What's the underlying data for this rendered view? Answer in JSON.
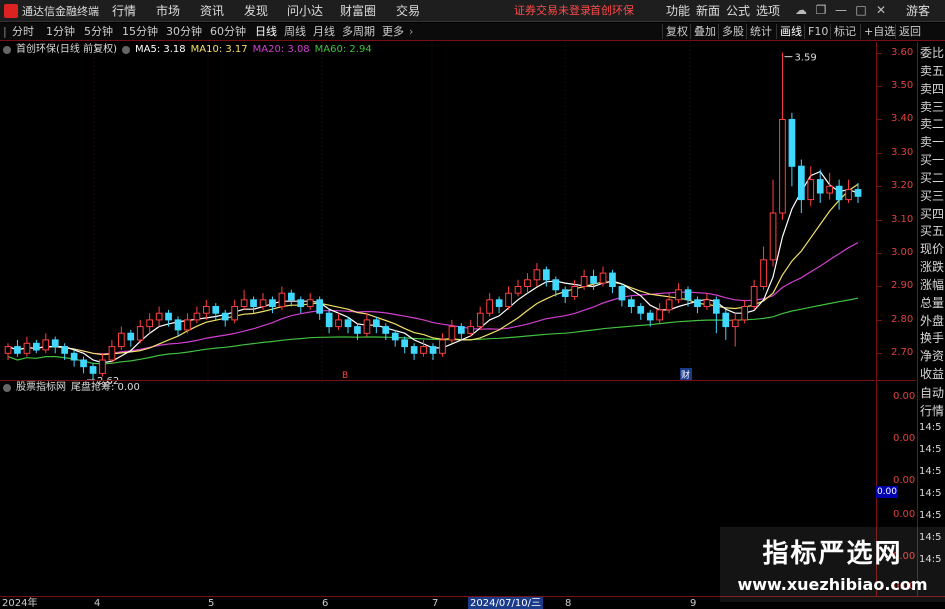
{
  "app": {
    "title": "通达信金融终端",
    "menus": [
      "行情",
      "市场",
      "资讯",
      "发现",
      "问小达",
      "财富圈",
      "交易"
    ],
    "notice": "证券交易未登录",
    "stock_short": "首创环保",
    "right_menus": [
      "功能",
      "新面",
      "公式",
      "选项"
    ],
    "guest": "游客"
  },
  "toolbar": {
    "periods": [
      "分时",
      "1分钟",
      "5分钟",
      "15分钟",
      "30分钟",
      "60分钟",
      "日线",
      "周线",
      "月线",
      "多周期",
      "更多"
    ],
    "active_period": "日线",
    "right_buttons": [
      "复权",
      "叠加",
      "多股",
      "统计",
      "画线",
      "F10",
      "标记",
      "+自选",
      "返回"
    ]
  },
  "main_chart": {
    "stock_label": "首创环保(日线 前复权)",
    "ma5_label": "MA5: 3.18",
    "ma10_label": "MA10: 3.17",
    "ma20_label": "MA20: 3.08",
    "ma60_label": "MA60: 2.94",
    "colors": {
      "ma5": "#ffffff",
      "ma10": "#f2e06a",
      "ma20": "#d040d0",
      "ma60": "#40c040",
      "up": "#ff4040",
      "down": "#40d8ff"
    },
    "high_label": "3.59",
    "low_label": "2.62",
    "marker_1": "B",
    "marker_2": "财"
  },
  "price_axis": [
    "3.60",
    "3.50",
    "3.40",
    "3.30",
    "3.20",
    "3.10",
    "3.00",
    "2.90",
    "2.80",
    "2.70"
  ],
  "sub_chart": {
    "indicator_label": "股票指标网",
    "value_label": "尾盘抢筹: 0.00",
    "axis": [
      "0.00",
      "0.00",
      "0.00",
      "0.00",
      "0.00",
      "0.00"
    ],
    "current_value": "0.00"
  },
  "side_panel": {
    "items": [
      "委比",
      "卖五",
      "卖四",
      "卖三",
      "卖二",
      "卖一",
      "买一",
      "买二",
      "买三",
      "买四",
      "买五",
      "现价",
      "涨跌",
      "涨幅",
      "总量",
      "外盘",
      "换手",
      "净资",
      "收益"
    ],
    "sub_items": [
      "自动",
      "行情"
    ],
    "times": [
      "14:5",
      "14:5",
      "14:5",
      "14:5",
      "14:5",
      "14:5",
      "14:5"
    ]
  },
  "date_axis": {
    "labels": [
      "2024年",
      "4",
      "5",
      "6",
      "7",
      "8",
      "9"
    ],
    "selected": "2024/07/10/三"
  },
  "watermark": {
    "title": "指标严选网",
    "url": "www.xuezhibiao.com"
  },
  "chart_data": {
    "type": "candlestick",
    "ylim": [
      2.62,
      3.62
    ],
    "candles": [
      [
        2.7,
        2.72,
        2.73,
        2.68
      ],
      [
        2.72,
        2.7,
        2.74,
        2.69
      ],
      [
        2.7,
        2.73,
        2.75,
        2.69
      ],
      [
        2.73,
        2.71,
        2.74,
        2.7
      ],
      [
        2.71,
        2.74,
        2.76,
        2.7
      ],
      [
        2.74,
        2.72,
        2.75,
        2.7
      ],
      [
        2.72,
        2.7,
        2.73,
        2.68
      ],
      [
        2.7,
        2.68,
        2.71,
        2.66
      ],
      [
        2.68,
        2.66,
        2.69,
        2.64
      ],
      [
        2.66,
        2.64,
        2.67,
        2.62
      ],
      [
        2.64,
        2.68,
        2.7,
        2.63
      ],
      [
        2.68,
        2.72,
        2.74,
        2.67
      ],
      [
        2.72,
        2.76,
        2.78,
        2.71
      ],
      [
        2.76,
        2.74,
        2.77,
        2.72
      ],
      [
        2.74,
        2.78,
        2.8,
        2.73
      ],
      [
        2.78,
        2.8,
        2.82,
        2.76
      ],
      [
        2.8,
        2.82,
        2.84,
        2.78
      ],
      [
        2.82,
        2.8,
        2.83,
        2.78
      ],
      [
        2.8,
        2.77,
        2.81,
        2.75
      ],
      [
        2.77,
        2.8,
        2.82,
        2.76
      ],
      [
        2.8,
        2.82,
        2.84,
        2.79
      ],
      [
        2.82,
        2.84,
        2.86,
        2.8
      ],
      [
        2.84,
        2.82,
        2.85,
        2.8
      ],
      [
        2.82,
        2.8,
        2.83,
        2.78
      ],
      [
        2.8,
        2.84,
        2.86,
        2.79
      ],
      [
        2.84,
        2.86,
        2.89,
        2.83
      ],
      [
        2.86,
        2.84,
        2.87,
        2.82
      ],
      [
        2.84,
        2.86,
        2.88,
        2.83
      ],
      [
        2.86,
        2.84,
        2.87,
        2.82
      ],
      [
        2.84,
        2.88,
        2.9,
        2.83
      ],
      [
        2.88,
        2.86,
        2.89,
        2.84
      ],
      [
        2.86,
        2.84,
        2.87,
        2.82
      ],
      [
        2.84,
        2.86,
        2.88,
        2.83
      ],
      [
        2.86,
        2.82,
        2.87,
        2.8
      ],
      [
        2.82,
        2.78,
        2.83,
        2.76
      ],
      [
        2.78,
        2.8,
        2.82,
        2.77
      ],
      [
        2.8,
        2.78,
        2.81,
        2.76
      ],
      [
        2.78,
        2.76,
        2.79,
        2.74
      ],
      [
        2.76,
        2.8,
        2.82,
        2.75
      ],
      [
        2.8,
        2.78,
        2.81,
        2.76
      ],
      [
        2.78,
        2.76,
        2.79,
        2.74
      ],
      [
        2.76,
        2.74,
        2.77,
        2.72
      ],
      [
        2.74,
        2.72,
        2.75,
        2.7
      ],
      [
        2.72,
        2.7,
        2.73,
        2.68
      ],
      [
        2.7,
        2.72,
        2.74,
        2.69
      ],
      [
        2.72,
        2.7,
        2.73,
        2.68
      ],
      [
        2.7,
        2.74,
        2.76,
        2.69
      ],
      [
        2.74,
        2.78,
        2.8,
        2.73
      ],
      [
        2.78,
        2.76,
        2.79,
        2.74
      ],
      [
        2.76,
        2.78,
        2.8,
        2.75
      ],
      [
        2.78,
        2.82,
        2.84,
        2.77
      ],
      [
        2.82,
        2.86,
        2.88,
        2.81
      ],
      [
        2.86,
        2.84,
        2.87,
        2.82
      ],
      [
        2.84,
        2.88,
        2.9,
        2.83
      ],
      [
        2.88,
        2.9,
        2.92,
        2.87
      ],
      [
        2.9,
        2.92,
        2.94,
        2.88
      ],
      [
        2.92,
        2.95,
        2.97,
        2.9
      ],
      [
        2.95,
        2.92,
        2.96,
        2.9
      ],
      [
        2.92,
        2.89,
        2.93,
        2.87
      ],
      [
        2.89,
        2.87,
        2.9,
        2.85
      ],
      [
        2.87,
        2.9,
        2.92,
        2.86
      ],
      [
        2.9,
        2.93,
        2.95,
        2.89
      ],
      [
        2.93,
        2.91,
        2.95,
        2.89
      ],
      [
        2.91,
        2.94,
        2.96,
        2.9
      ],
      [
        2.94,
        2.9,
        2.95,
        2.88
      ],
      [
        2.9,
        2.86,
        2.91,
        2.84
      ],
      [
        2.86,
        2.84,
        2.87,
        2.82
      ],
      [
        2.84,
        2.82,
        2.85,
        2.8
      ],
      [
        2.82,
        2.8,
        2.83,
        2.78
      ],
      [
        2.8,
        2.83,
        2.85,
        2.79
      ],
      [
        2.83,
        2.86,
        2.88,
        2.82
      ],
      [
        2.86,
        2.89,
        2.91,
        2.85
      ],
      [
        2.89,
        2.86,
        2.9,
        2.84
      ],
      [
        2.86,
        2.84,
        2.87,
        2.82
      ],
      [
        2.84,
        2.86,
        2.88,
        2.83
      ],
      [
        2.86,
        2.82,
        2.87,
        2.76
      ],
      [
        2.82,
        2.78,
        2.83,
        2.74
      ],
      [
        2.78,
        2.8,
        2.82,
        2.72
      ],
      [
        2.8,
        2.84,
        2.86,
        2.79
      ],
      [
        2.84,
        2.9,
        2.92,
        2.83
      ],
      [
        2.9,
        2.98,
        3.02,
        2.89
      ],
      [
        2.98,
        3.12,
        3.22,
        2.96
      ],
      [
        3.12,
        3.4,
        3.6,
        3.1
      ],
      [
        3.4,
        3.26,
        3.42,
        3.2
      ],
      [
        3.26,
        3.16,
        3.28,
        3.12
      ],
      [
        3.16,
        3.22,
        3.26,
        3.14
      ],
      [
        3.22,
        3.18,
        3.25,
        3.15
      ],
      [
        3.18,
        3.2,
        3.24,
        3.16
      ],
      [
        3.2,
        3.16,
        3.22,
        3.13
      ],
      [
        3.16,
        3.19,
        3.22,
        3.15
      ],
      [
        3.19,
        3.17,
        3.21,
        3.15
      ]
    ]
  }
}
